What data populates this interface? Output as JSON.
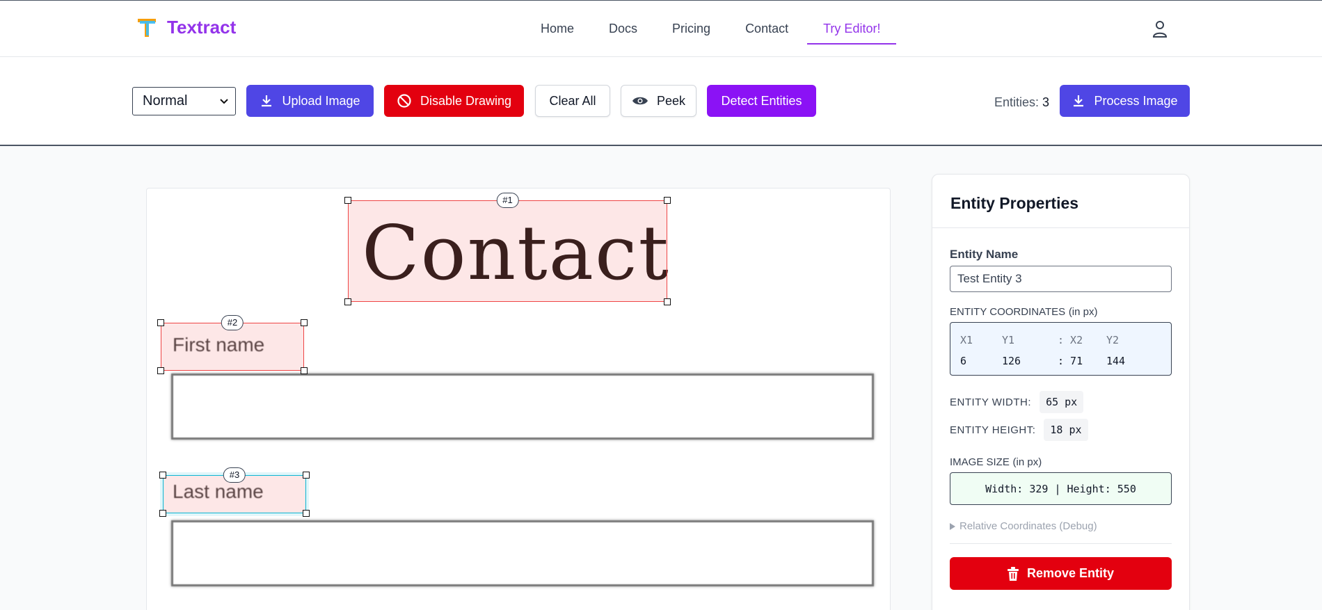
{
  "brand": {
    "name": "Textract"
  },
  "nav": {
    "links": [
      "Home",
      "Docs",
      "Pricing",
      "Contact",
      "Try Editor!"
    ],
    "active": "Try Editor!"
  },
  "toolbar": {
    "mode_select": {
      "value": "Normal",
      "options": [
        "Normal"
      ]
    },
    "upload_label": "Upload Image",
    "disable_drawing_label": "Disable Drawing",
    "clear_all_label": "Clear All",
    "peek_label": "Peek",
    "detect_label": "Detect Entities",
    "entities_label": "Entities:",
    "entities_count": "3",
    "process_label": "Process Image"
  },
  "image": {
    "heading": "Contact",
    "label_first": "First name",
    "label_last": "Last name"
  },
  "entities": [
    {
      "tag": "#1",
      "selected": false
    },
    {
      "tag": "#2",
      "selected": false
    },
    {
      "tag": "#3",
      "selected": true
    }
  ],
  "panel": {
    "title": "Entity Properties",
    "entity_name_label": "Entity Name",
    "entity_name_value": "Test Entity 3",
    "coords_label": "ENTITY COORDINATES",
    "coords_unit": "(in px)",
    "coords_headers": [
      "X1",
      "Y1",
      ": X2",
      "Y2"
    ],
    "coords_values": [
      "6",
      "126",
      ": 71",
      "144"
    ],
    "width_label": "ENTITY WIDTH:",
    "width_value": "65 px",
    "height_label": "ENTITY HEIGHT:",
    "height_value": "18 px",
    "image_size_label": "IMAGE SIZE",
    "image_size_unit": "(in px)",
    "image_size_value": "Width: 329 | Height: 550",
    "debug_label": "Relative Coordinates (Debug)",
    "remove_label": "Remove Entity"
  },
  "colors": {
    "brand_purple": "#9333ea",
    "indigo": "#4f46e5",
    "danger": "#e3000f",
    "detect_purple": "#8b12f5",
    "selected_border": "#06b6d4"
  }
}
